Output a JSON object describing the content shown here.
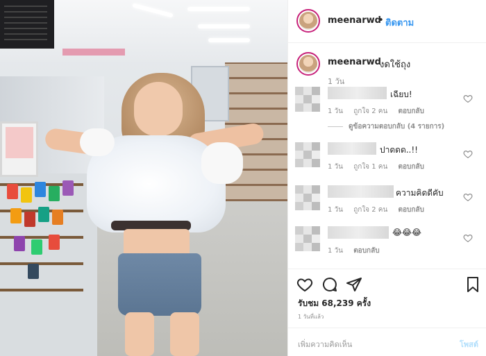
{
  "header": {
    "username": "meenarwd",
    "dot": "•",
    "follow_label": "ติดตาม"
  },
  "caption": {
    "username": "meenarwd",
    "text": "งดใช้ถุง",
    "time": "1 วัน"
  },
  "comments": [
    {
      "text": "เฉียบ!",
      "time": "1 วัน",
      "likes": "ถูกใจ 2 คน",
      "reply": "ตอบกลับ"
    },
    {
      "text": "ปาดดด..!!",
      "time": "1 วัน",
      "likes": "ถูกใจ 1 คน",
      "reply": "ตอบกลับ"
    },
    {
      "text": "ความคิดดีคับ",
      "time": "1 วัน",
      "likes": "ถูกใจ 2 คน",
      "reply": "ตอบกลับ"
    },
    {
      "text": "😂😂😂",
      "time": "1 วัน",
      "likes": "",
      "reply": "ตอบกลับ"
    }
  ],
  "view_replies": "ดูข้อความตอบกลับ (4 รายการ)",
  "stats": {
    "views": "รับชม 68,239 ครั้ง",
    "ago": "1 วันที่แล้ว"
  },
  "comment_box": {
    "placeholder": "เพิ่มความคิดเห็น",
    "post_label": "โพสต์"
  },
  "icons": [
    "heart-icon",
    "comment-icon",
    "share-icon",
    "bookmark-icon"
  ]
}
